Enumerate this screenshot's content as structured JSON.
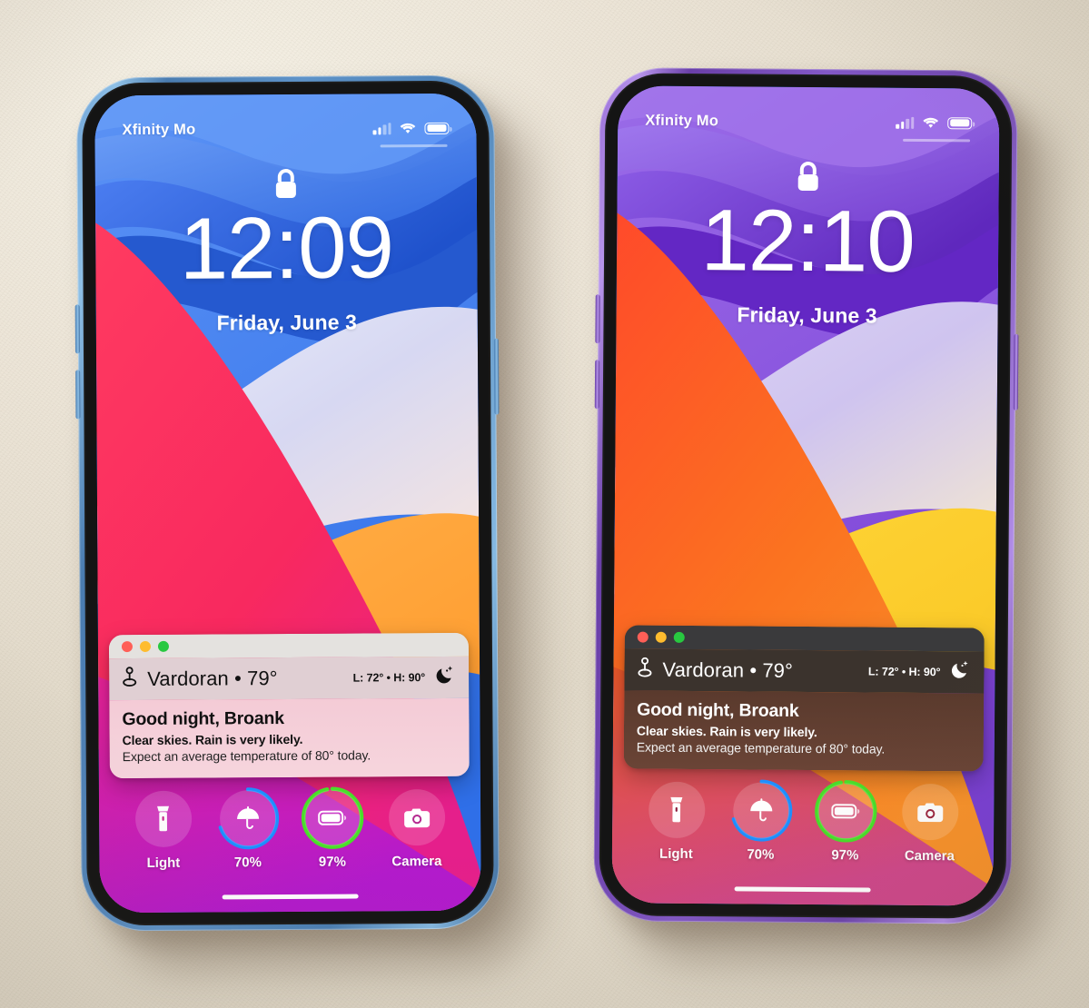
{
  "background": {
    "color": "#f0eade"
  },
  "phones": [
    {
      "id": "left",
      "frame_color": "#5e93c8",
      "frame_name": "blue",
      "theme": "light",
      "status_bar": {
        "carrier": "Xfinity Mo",
        "signal_icon": "cellular-bars-icon",
        "wifi_icon": "wifi-icon",
        "battery_icon": "battery-full-icon",
        "signal_bars_active": 2,
        "signal_bars_total": 4
      },
      "lock_icon": "lock-closed-icon",
      "clock": {
        "time": "12:09",
        "date": "Friday, June 3"
      },
      "widget": {
        "window_controls": [
          "close",
          "minimize",
          "zoom"
        ],
        "location_icon": "location-pin-icon",
        "location_line": "Vardoran • 79°",
        "high_low": "L: 72° • H: 90°",
        "condition_icon": "moon-stars-icon",
        "greeting": "Good night, Broank",
        "condition": "Clear skies. Rain is very likely.",
        "average": "Expect an average temperature of 80° today."
      },
      "toolbar": [
        {
          "icon": "flashlight-icon",
          "label": "Light",
          "ring": null
        },
        {
          "icon": "umbrella-icon",
          "label": "70%",
          "ring": {
            "percent": 70,
            "color": "#1e8fff"
          }
        },
        {
          "icon": "battery-icon",
          "label": "97%",
          "ring": {
            "percent": 97,
            "color": "#4ade2a"
          }
        },
        {
          "icon": "camera-icon",
          "label": "Camera",
          "ring": null
        }
      ],
      "home_indicator": "home-bar"
    },
    {
      "id": "right",
      "frame_color": "#8258c6",
      "frame_name": "purple",
      "theme": "dark",
      "status_bar": {
        "carrier": "Xfinity Mo",
        "signal_icon": "cellular-bars-icon",
        "wifi_icon": "wifi-icon",
        "battery_icon": "battery-full-icon",
        "signal_bars_active": 2,
        "signal_bars_total": 4
      },
      "lock_icon": "lock-closed-icon",
      "clock": {
        "time": "12:10",
        "date": "Friday, June 3"
      },
      "widget": {
        "window_controls": [
          "close",
          "minimize",
          "zoom"
        ],
        "location_icon": "location-pin-icon",
        "location_line": "Vardoran • 79°",
        "high_low": "L: 72° • H: 90°",
        "condition_icon": "moon-stars-icon",
        "greeting": "Good night, Broank",
        "condition": "Clear skies. Rain is very likely.",
        "average": "Expect an average temperature of 80° today."
      },
      "toolbar": [
        {
          "icon": "flashlight-icon",
          "label": "Light",
          "ring": null
        },
        {
          "icon": "umbrella-icon",
          "label": "70%",
          "ring": {
            "percent": 70,
            "color": "#1e8fff"
          }
        },
        {
          "icon": "battery-icon",
          "label": "97%",
          "ring": {
            "percent": 97,
            "color": "#4ade2a"
          }
        },
        {
          "icon": "camera-icon",
          "label": "Camera",
          "ring": null
        }
      ],
      "home_indicator": "home-bar"
    }
  ]
}
